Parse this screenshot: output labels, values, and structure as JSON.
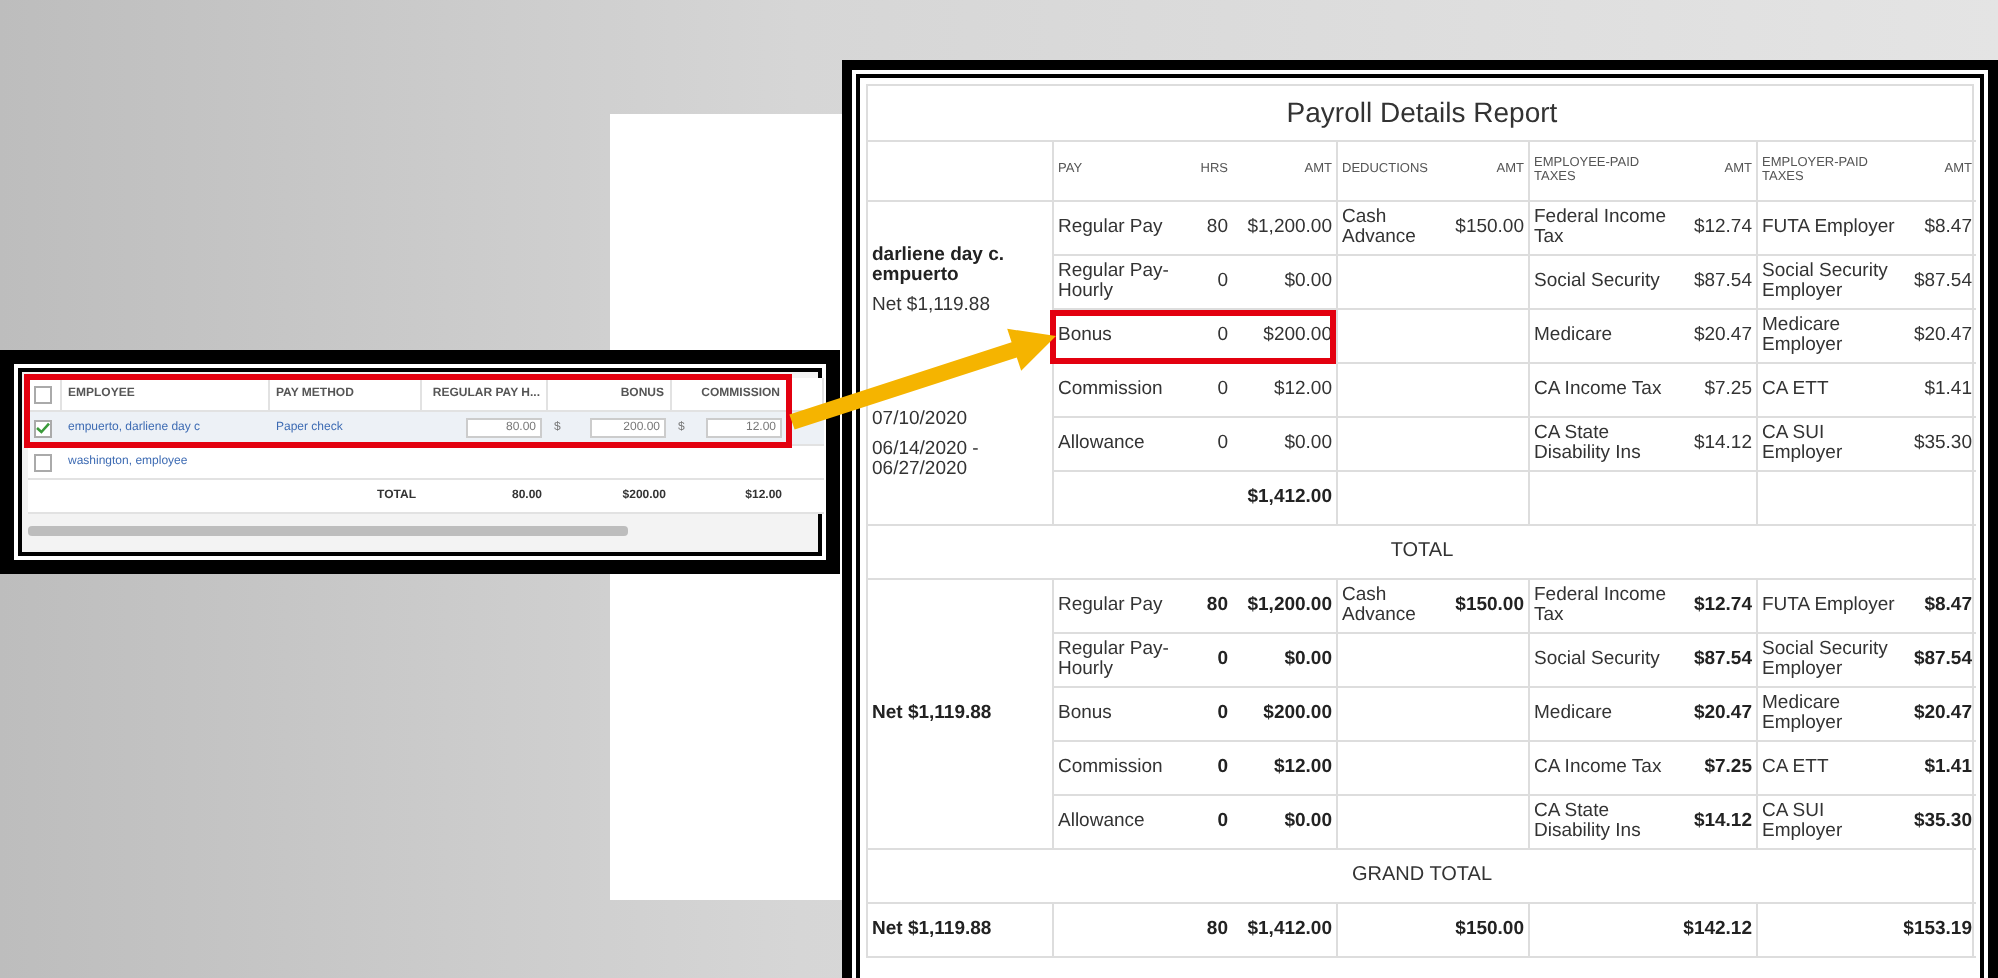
{
  "payroll_grid": {
    "header_checkbox": {
      "checked": false
    },
    "columns": [
      "EMPLOYEE",
      "PAY METHOD",
      "REGULAR PAY H...",
      "BONUS",
      "COMMISSION"
    ],
    "rows": [
      {
        "checked": true,
        "employee": "empuerto, darliene day c",
        "pay_method": "Paper check",
        "regular_pay_hours": "80.00",
        "bonus_currency": "$",
        "bonus": "200.00",
        "commission_currency": "$",
        "commission": "12.00"
      },
      {
        "checked": false,
        "employee": "washington, employee"
      }
    ],
    "totals": {
      "label": "TOTAL",
      "regular_pay_hours": "80.00",
      "bonus": "$200.00",
      "commission": "$12.00"
    }
  },
  "report": {
    "title": "Payroll Details Report",
    "columns": [
      "PAY",
      "HRS",
      "AMT",
      "DEDUCTIONS",
      "AMT",
      "EMPLOYEE-PAID TAXES",
      "AMT",
      "EMPLOYER-PAID TAXES",
      "AMT"
    ],
    "blocks": [
      {
        "kind": "employee",
        "name": "darliene day c. empuerto",
        "lines": [
          "Net $1,119.88",
          "07/10/2020",
          "06/14/2020 - 06/27/2020"
        ],
        "rows": [
          {
            "highlighted": false,
            "pay": "Regular Pay",
            "hours": "80",
            "amount": "$1,200.00",
            "deduction": "Cash Advance",
            "deduction_amount": "$150.00",
            "employee_tax": "Federal Income Tax",
            "employee_tax_amount": "$12.74",
            "employer_tax": "FUTA Employer",
            "employer_tax_amount": "$8.47"
          },
          {
            "highlighted": false,
            "pay": "Regular Pay-Hourly",
            "hours": "0",
            "amount": "$0.00",
            "employee_tax": "Social Security",
            "employee_tax_amount": "$87.54",
            "employer_tax": "Social Security Employer",
            "employer_tax_amount": "$87.54"
          },
          {
            "highlighted": true,
            "pay": "Bonus",
            "hours": "0",
            "amount": "$200.00",
            "employee_tax": "Medicare",
            "employee_tax_amount": "$20.47",
            "employer_tax": "Medicare Employer",
            "employer_tax_amount": "$20.47"
          },
          {
            "highlighted": false,
            "pay": "Commission",
            "hours": "0",
            "amount": "$12.00",
            "employee_tax": "CA Income Tax",
            "employee_tax_amount": "$7.25",
            "employer_tax": "CA ETT",
            "employer_tax_amount": "$1.41"
          },
          {
            "highlighted": false,
            "pay": "Allowance",
            "hours": "0",
            "amount": "$0.00",
            "employee_tax": "CA State Disability Ins",
            "employee_tax_amount": "$14.12",
            "employer_tax": "CA SUI Employer",
            "employer_tax_amount": "$35.30"
          }
        ],
        "pay_total": "$1,412.00"
      },
      {
        "kind": "label",
        "text": "TOTAL"
      },
      {
        "kind": "summary",
        "net": "Net $1,119.88",
        "rows": [
          {
            "pay": "Regular Pay",
            "hours": "80",
            "amount": "$1,200.00",
            "deduction": "Cash Advance",
            "deduction_amount": "$150.00",
            "employee_tax": "Federal Income Tax",
            "employee_tax_amount": "$12.74",
            "employer_tax": "FUTA Employer",
            "employer_tax_amount": "$8.47"
          },
          {
            "pay": "Regular Pay-Hourly",
            "hours": "0",
            "amount": "$0.00",
            "employee_tax": "Social Security",
            "employee_tax_amount": "$87.54",
            "employer_tax": "Social Security Employer",
            "employer_tax_amount": "$87.54"
          },
          {
            "pay": "Bonus",
            "hours": "0",
            "amount": "$200.00",
            "employee_tax": "Medicare",
            "employee_tax_amount": "$20.47",
            "employer_tax": "Medicare Employer",
            "employer_tax_amount": "$20.47"
          },
          {
            "pay": "Commission",
            "hours": "0",
            "amount": "$12.00",
            "employee_tax": "CA Income Tax",
            "employee_tax_amount": "$7.25",
            "employer_tax": "CA ETT",
            "employer_tax_amount": "$1.41"
          },
          {
            "pay": "Allowance",
            "hours": "0",
            "amount": "$0.00",
            "employee_tax": "CA State Disability Ins",
            "employee_tax_amount": "$14.12",
            "employer_tax": "CA SUI Employer",
            "employer_tax_amount": "$35.30"
          }
        ]
      },
      {
        "kind": "label",
        "text": "GRAND TOTAL"
      },
      {
        "kind": "totals",
        "net": "Net $1,119.88",
        "hours": "80",
        "amount": "$1,412.00",
        "deduction_amount": "$150.00",
        "employee_tax_amount": "$142.12",
        "employer_tax_amount": "$153.19"
      }
    ]
  }
}
